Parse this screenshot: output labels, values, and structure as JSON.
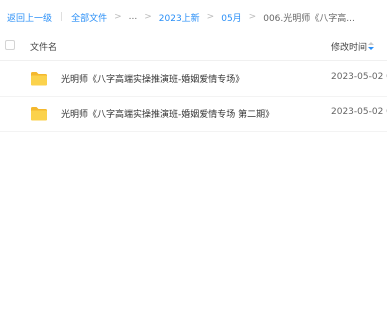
{
  "breadcrumb": {
    "back": "返回上一级",
    "all_files": "全部文件",
    "ellipsis": "...",
    "level1": "2023上新",
    "level2": "05月",
    "current": "006.光明师《八字高..."
  },
  "table": {
    "headers": {
      "name": "文件名",
      "modified": "修改时间"
    },
    "rows": [
      {
        "name": "光明师《八字高端实操推演班-婚姻爱情专场》",
        "modified": "2023-05-02 0",
        "icon": "folder-icon"
      },
      {
        "name": "光明师《八字高端实操推演班-婚姻爱情专场 第二期》",
        "modified": "2023-05-02 0",
        "icon": "folder-icon"
      }
    ]
  },
  "colors": {
    "link": "#2a8ff7",
    "folder": "#f8c93a",
    "sort_active": "#2a8ff7"
  }
}
